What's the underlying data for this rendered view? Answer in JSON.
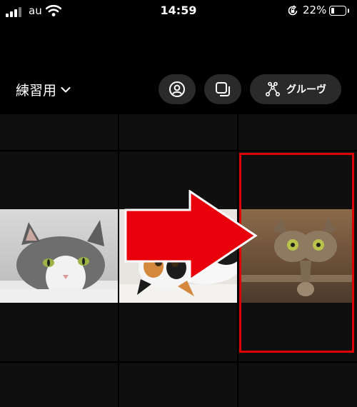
{
  "status": {
    "carrier": "au",
    "time": "14:59",
    "battery": "22%",
    "battery_level": 0.22
  },
  "toolbar": {
    "album_title": "練習用",
    "group_label": "グルーヴ"
  },
  "icons": [
    "signal-icon",
    "wifi-icon",
    "rotation-lock-icon",
    "battery-icon",
    "chevron-down-icon",
    "profile-icon",
    "multi-select-icon",
    "group-icon",
    "red-arrow-icon"
  ],
  "colors": {
    "highlight": "#e00000",
    "background": "#000000",
    "cell": "#0f0f0f",
    "pill": "#2a2a2a"
  },
  "photos": [
    {
      "subject": "gray-white cat lying down"
    },
    {
      "subject": "calico cat upside down"
    },
    {
      "subject": "tabby cat mirrored warp effect"
    }
  ]
}
